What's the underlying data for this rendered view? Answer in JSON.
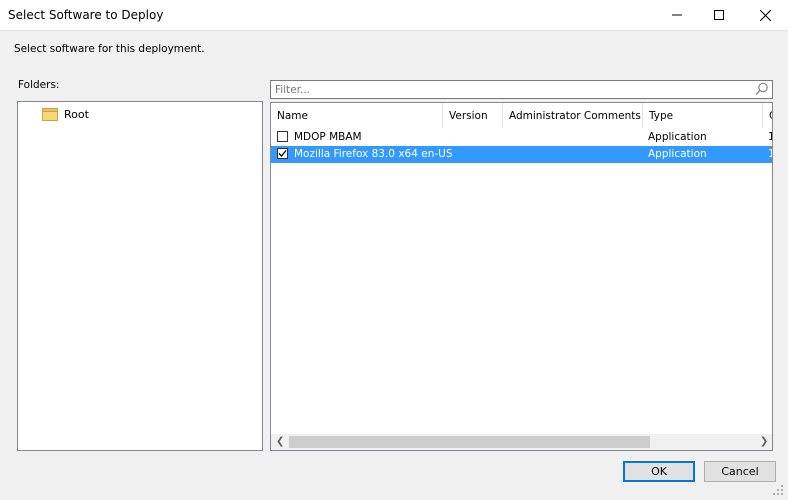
{
  "window": {
    "title": "Select Software to Deploy"
  },
  "subtitle": "Select software for this deployment.",
  "folders": {
    "label": "Folders:",
    "items": [
      {
        "label": "Root"
      }
    ]
  },
  "filter": {
    "placeholder": "Filter..."
  },
  "table": {
    "columns": [
      "Name",
      "Version",
      "Administrator Comments",
      "Type",
      "C"
    ],
    "rows": [
      {
        "name": "MDOP MBAM",
        "version": "",
        "comments": "",
        "type": "Application",
        "extra": "1",
        "checked": false,
        "selected": false
      },
      {
        "name": "Mozilla Firefox 83.0 x64 en-US",
        "version": "",
        "comments": "",
        "type": "Application",
        "extra": "1",
        "checked": true,
        "selected": true
      }
    ]
  },
  "buttons": {
    "ok": "OK",
    "cancel": "Cancel"
  },
  "colors": {
    "selection": "#3399ff",
    "accent": "#0078d7"
  }
}
